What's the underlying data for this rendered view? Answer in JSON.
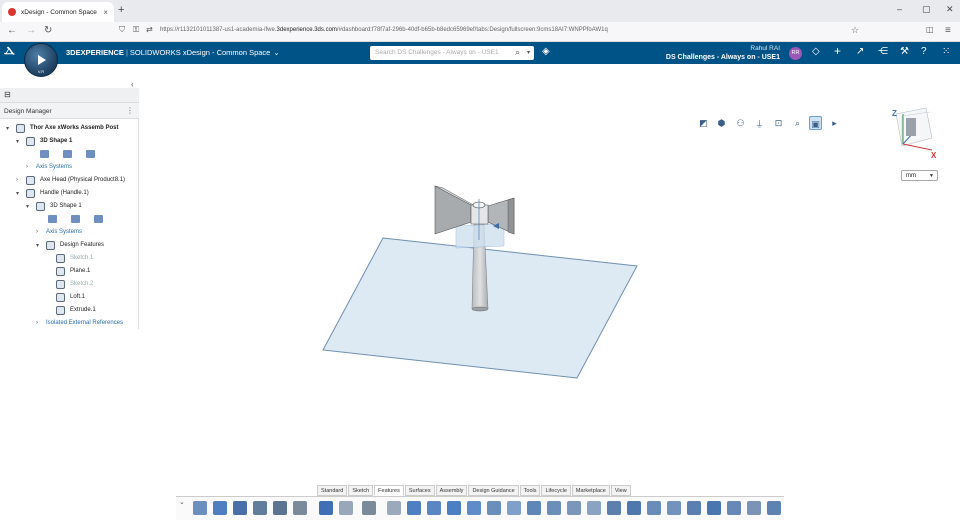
{
  "browser": {
    "tab_title": "xDesign - Common Space",
    "tab_close": "×",
    "new_tab": "+",
    "url_prefix": "https://r1132101011387-us1-academia-ifwe.",
    "url_domain": "3dexperience.3ds.com",
    "url_suffix": "/#dashboard:f78f7af-296b-40df-b65b-b8edc65969ef/tabs:Design/fullscreen:9cms18AI7:WNPPfoAW1q",
    "window_min": "–",
    "window_max": "▢",
    "window_close": "✕"
  },
  "appbar": {
    "logo": "3DS",
    "version": "V.R",
    "brand_3dx": "3DEXPERIENCE",
    "brand_sep": "|",
    "brand_app": "SOLIDWORKS xDesign - Common Space",
    "search_placeholder": "Search DS Challenges - Always on - USE1",
    "user_name": "Rahul RAI",
    "space": "DS Challenges - Always on - USE1",
    "avatar": "RR"
  },
  "panel": {
    "title": "Design Manager",
    "menu": "⋮",
    "collapse": "‹",
    "tree": [
      {
        "label": "Thor Axe xWorks Assemb Post",
        "style": "bold"
      },
      {
        "label": "3D Shape 1",
        "style": "bold"
      },
      {
        "label": "Axis Systems",
        "style": "blue"
      },
      {
        "label": "Axe Head (Physical Product8.1)",
        "style": ""
      },
      {
        "label": "Handle (Handle.1)",
        "style": ""
      },
      {
        "label": "3D Shape 1",
        "style": ""
      },
      {
        "label": "Axis Systems",
        "style": "blue"
      },
      {
        "label": "Design Features",
        "style": ""
      },
      {
        "label": "Sketch.1",
        "style": "grey"
      },
      {
        "label": "Plane.1",
        "style": ""
      },
      {
        "label": "Sketch.2",
        "style": "grey"
      },
      {
        "label": "Loft.1",
        "style": ""
      },
      {
        "label": "Extrude.1",
        "style": ""
      },
      {
        "label": "Isolated External References",
        "style": "blue"
      }
    ]
  },
  "viewport": {
    "units": "mm",
    "axis_z": "Z",
    "axis_x": "X"
  },
  "command_tabs": [
    "Standard",
    "Sketch",
    "Features",
    "Surfaces",
    "Assembly",
    "Design Guidance",
    "Tools",
    "Lifecycle",
    "Marketplace",
    "View"
  ],
  "active_command_tab": "Features",
  "colors": {
    "appbar": "#005386",
    "plane_fill": "#dde9f3",
    "plane_stroke": "#6f8fb0",
    "model": "#c8cbce"
  }
}
